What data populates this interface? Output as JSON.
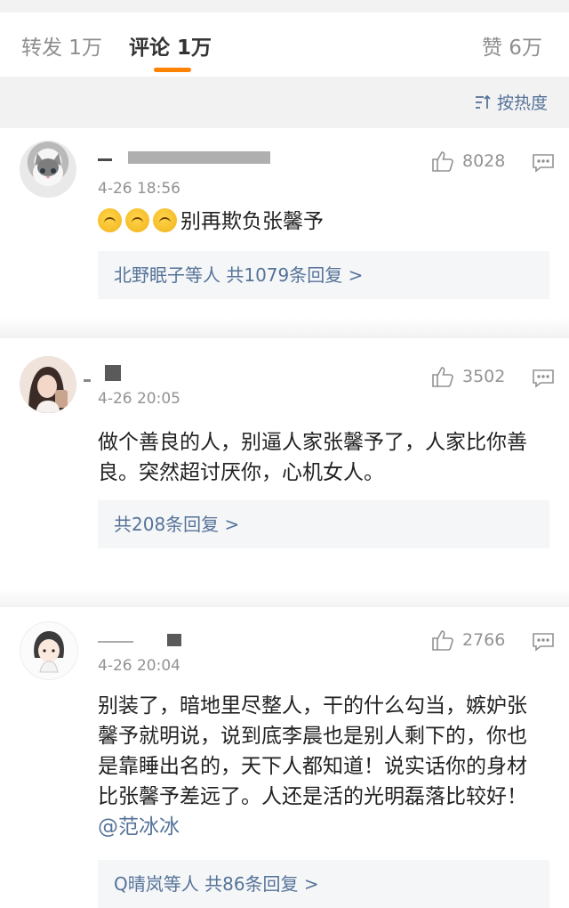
{
  "tabs": {
    "repost": "转发 1万",
    "comments": "评论 1万",
    "likes": "赞 6万",
    "accent_color": "#ff8200"
  },
  "sort": {
    "label": "按热度",
    "icon": "sort-icon",
    "color": "#56739a"
  },
  "comments": [
    {
      "time": "4-26 18:56",
      "likes": "8028",
      "text": "别再欺负张馨予",
      "emoji_count": 3,
      "emoji_icon": "upside-down-face-emoji",
      "replies": "北野眠子等人  共1079条回复 >"
    },
    {
      "time": "4-26 20:05",
      "likes": "3502",
      "text": "做个善良的人，别逼人家张馨予了，人家比你善良。突然超讨厌你，心机女人。",
      "replies": "共208条回复 >"
    },
    {
      "time": "4-26 20:04",
      "likes": "2766",
      "text": "别装了，暗地里尽整人，干的什么勾当，嫉妒张馨予就明说，说到底李晨也是别人剩下的，你也是靠睡出名的，天下人都知道！说实话你的身材比张馨予差远了。人还是活的光明磊落比较好！",
      "mention": "@范冰冰",
      "replies": "Q晴岚等人  共86条回复 >"
    }
  ]
}
